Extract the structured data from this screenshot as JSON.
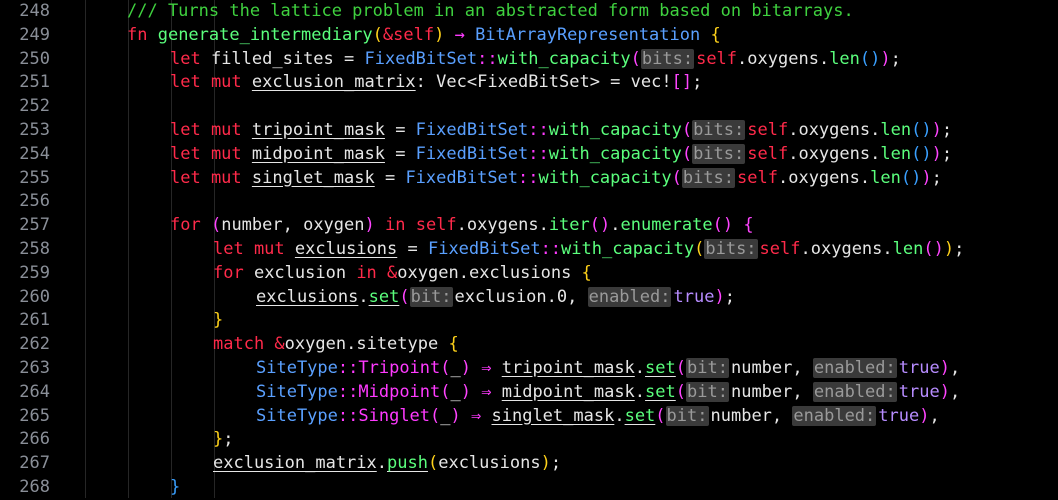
{
  "editor": {
    "lines": [
      {
        "n": "248",
        "tokens": [
          {
            "t": "/// Turns the lattice problem in an abstracted form based on bitarrays.",
            "c": "c"
          }
        ],
        "indent": 1
      },
      {
        "n": "249",
        "tokens": [
          {
            "t": "fn ",
            "c": "k"
          },
          {
            "t": "generate_intermediary",
            "c": "fn"
          },
          {
            "t": "(",
            "c": "br1"
          },
          {
            "t": "&self",
            "c": "k"
          },
          {
            "t": ")",
            "c": "br1"
          },
          {
            "t": " → ",
            "c": "ar"
          },
          {
            "t": "BitArrayRepresentation",
            "c": "ty"
          },
          {
            "t": " {",
            "c": "br1"
          }
        ],
        "indent": 1
      },
      {
        "n": "250",
        "tokens": [
          {
            "t": "let ",
            "c": "k"
          },
          {
            "t": "filled_sites",
            "c": "id"
          },
          {
            "t": " = ",
            "c": "p"
          },
          {
            "t": "FixedBitSet",
            "c": "ty"
          },
          {
            "t": "::",
            "c": "ar"
          },
          {
            "t": "with_capacity",
            "c": "fn"
          },
          {
            "t": "(",
            "c": "br2"
          },
          {
            "t": "bits:",
            "c": "hint"
          },
          {
            "t": "self",
            "c": "k"
          },
          {
            "t": ".",
            "c": "p"
          },
          {
            "t": "oxygens",
            "c": "id"
          },
          {
            "t": ".",
            "c": "p"
          },
          {
            "t": "len",
            "c": "fn"
          },
          {
            "t": "()",
            "c": "br3"
          },
          {
            "t": ")",
            "c": "br2"
          },
          {
            "t": ";",
            "c": "p"
          }
        ],
        "indent": 2
      },
      {
        "n": "251",
        "tokens": [
          {
            "t": "let mut ",
            "c": "k"
          },
          {
            "t": "exclusion_matrix",
            "c": "idu"
          },
          {
            "t": ": ",
            "c": "p"
          },
          {
            "t": "Vec",
            "c": "id"
          },
          {
            "t": "<",
            "c": "p"
          },
          {
            "t": "FixedBitSet",
            "c": "id"
          },
          {
            "t": "> = ",
            "c": "p"
          },
          {
            "t": "vec!",
            "c": "id"
          },
          {
            "t": "[]",
            "c": "br2"
          },
          {
            "t": ";",
            "c": "p"
          }
        ],
        "indent": 2
      },
      {
        "n": "252",
        "tokens": [],
        "indent": 2
      },
      {
        "n": "253",
        "tokens": [
          {
            "t": "let mut ",
            "c": "k"
          },
          {
            "t": "tripoint_mask",
            "c": "idu"
          },
          {
            "t": " = ",
            "c": "p"
          },
          {
            "t": "FixedBitSet",
            "c": "ty"
          },
          {
            "t": "::",
            "c": "ar"
          },
          {
            "t": "with_capacity",
            "c": "fn"
          },
          {
            "t": "(",
            "c": "br2"
          },
          {
            "t": "bits:",
            "c": "hint"
          },
          {
            "t": "self",
            "c": "k"
          },
          {
            "t": ".",
            "c": "p"
          },
          {
            "t": "oxygens",
            "c": "id"
          },
          {
            "t": ".",
            "c": "p"
          },
          {
            "t": "len",
            "c": "fn"
          },
          {
            "t": "()",
            "c": "br3"
          },
          {
            "t": ")",
            "c": "br2"
          },
          {
            "t": ";",
            "c": "p"
          }
        ],
        "indent": 2
      },
      {
        "n": "254",
        "tokens": [
          {
            "t": "let mut ",
            "c": "k"
          },
          {
            "t": "midpoint_mask",
            "c": "idu"
          },
          {
            "t": " = ",
            "c": "p"
          },
          {
            "t": "FixedBitSet",
            "c": "ty"
          },
          {
            "t": "::",
            "c": "ar"
          },
          {
            "t": "with_capacity",
            "c": "fn"
          },
          {
            "t": "(",
            "c": "br2"
          },
          {
            "t": "bits:",
            "c": "hint"
          },
          {
            "t": "self",
            "c": "k"
          },
          {
            "t": ".",
            "c": "p"
          },
          {
            "t": "oxygens",
            "c": "id"
          },
          {
            "t": ".",
            "c": "p"
          },
          {
            "t": "len",
            "c": "fn"
          },
          {
            "t": "()",
            "c": "br3"
          },
          {
            "t": ")",
            "c": "br2"
          },
          {
            "t": ";",
            "c": "p"
          }
        ],
        "indent": 2
      },
      {
        "n": "255",
        "tokens": [
          {
            "t": "let mut ",
            "c": "k"
          },
          {
            "t": "singlet_mask",
            "c": "idu"
          },
          {
            "t": " = ",
            "c": "p"
          },
          {
            "t": "FixedBitSet",
            "c": "ty"
          },
          {
            "t": "::",
            "c": "ar"
          },
          {
            "t": "with_capacity",
            "c": "fn"
          },
          {
            "t": "(",
            "c": "br2"
          },
          {
            "t": "bits:",
            "c": "hint"
          },
          {
            "t": "self",
            "c": "k"
          },
          {
            "t": ".",
            "c": "p"
          },
          {
            "t": "oxygens",
            "c": "id"
          },
          {
            "t": ".",
            "c": "p"
          },
          {
            "t": "len",
            "c": "fn"
          },
          {
            "t": "()",
            "c": "br3"
          },
          {
            "t": ")",
            "c": "br2"
          },
          {
            "t": ";",
            "c": "p"
          }
        ],
        "indent": 2
      },
      {
        "n": "256",
        "tokens": [],
        "indent": 2
      },
      {
        "n": "257",
        "tokens": [
          {
            "t": "for ",
            "c": "k"
          },
          {
            "t": "(",
            "c": "br2"
          },
          {
            "t": "number, oxygen",
            "c": "id"
          },
          {
            "t": ")",
            "c": "br2"
          },
          {
            "t": " in ",
            "c": "k"
          },
          {
            "t": "self",
            "c": "k"
          },
          {
            "t": ".",
            "c": "p"
          },
          {
            "t": "oxygens",
            "c": "id"
          },
          {
            "t": ".",
            "c": "p"
          },
          {
            "t": "iter",
            "c": "fn"
          },
          {
            "t": "()",
            "c": "br2"
          },
          {
            "t": ".",
            "c": "p"
          },
          {
            "t": "enumerate",
            "c": "fn"
          },
          {
            "t": "()",
            "c": "br2"
          },
          {
            "t": " {",
            "c": "br2"
          }
        ],
        "indent": 2
      },
      {
        "n": "258",
        "tokens": [
          {
            "t": "let mut ",
            "c": "k"
          },
          {
            "t": "exclusions",
            "c": "idu"
          },
          {
            "t": " = ",
            "c": "p"
          },
          {
            "t": "FixedBitSet",
            "c": "ty"
          },
          {
            "t": "::",
            "c": "ar"
          },
          {
            "t": "with_capacity",
            "c": "fn"
          },
          {
            "t": "(",
            "c": "br1"
          },
          {
            "t": "bits:",
            "c": "hint"
          },
          {
            "t": "self",
            "c": "k"
          },
          {
            "t": ".",
            "c": "p"
          },
          {
            "t": "oxygens",
            "c": "id"
          },
          {
            "t": ".",
            "c": "p"
          },
          {
            "t": "len",
            "c": "fn"
          },
          {
            "t": "()",
            "c": "br2"
          },
          {
            "t": ")",
            "c": "br1"
          },
          {
            "t": ";",
            "c": "p"
          }
        ],
        "indent": 3
      },
      {
        "n": "259",
        "tokens": [
          {
            "t": "for ",
            "c": "k"
          },
          {
            "t": "exclusion",
            "c": "id"
          },
          {
            "t": " in ",
            "c": "k"
          },
          {
            "t": "&",
            "c": "k"
          },
          {
            "t": "oxygen",
            "c": "id"
          },
          {
            "t": ".",
            "c": "p"
          },
          {
            "t": "exclusions",
            "c": "id"
          },
          {
            "t": " {",
            "c": "br1"
          }
        ],
        "indent": 3
      },
      {
        "n": "260",
        "tokens": [
          {
            "t": "exclusions",
            "c": "idu"
          },
          {
            "t": ".",
            "c": "p"
          },
          {
            "t": "set",
            "c": "fnu"
          },
          {
            "t": "(",
            "c": "br2"
          },
          {
            "t": "bit:",
            "c": "hint"
          },
          {
            "t": "exclusion.0, ",
            "c": "id"
          },
          {
            "t": "enabled:",
            "c": "hint"
          },
          {
            "t": "true",
            "c": "lit"
          },
          {
            "t": ")",
            "c": "br2"
          },
          {
            "t": ";",
            "c": "p"
          }
        ],
        "indent": 4
      },
      {
        "n": "261",
        "tokens": [
          {
            "t": "}",
            "c": "br1"
          }
        ],
        "indent": 3
      },
      {
        "n": "262",
        "tokens": [
          {
            "t": "match ",
            "c": "k"
          },
          {
            "t": "&",
            "c": "k"
          },
          {
            "t": "oxygen",
            "c": "id"
          },
          {
            "t": ".",
            "c": "p"
          },
          {
            "t": "sitetype",
            "c": "id"
          },
          {
            "t": " {",
            "c": "br1"
          }
        ],
        "indent": 3
      },
      {
        "n": "263",
        "tokens": [
          {
            "t": "SiteType",
            "c": "ty"
          },
          {
            "t": "::",
            "c": "ar"
          },
          {
            "t": "Tripoint",
            "c": "ar"
          },
          {
            "t": "(",
            "c": "br2"
          },
          {
            "t": "_",
            "c": "id"
          },
          {
            "t": ")",
            "c": "br2"
          },
          {
            "t": " ⇒ ",
            "c": "ar"
          },
          {
            "t": "tripoint_mask",
            "c": "idu"
          },
          {
            "t": ".",
            "c": "p"
          },
          {
            "t": "set",
            "c": "fnu"
          },
          {
            "t": "(",
            "c": "br2"
          },
          {
            "t": "bit:",
            "c": "hint"
          },
          {
            "t": "number, ",
            "c": "id"
          },
          {
            "t": "enabled:",
            "c": "hint"
          },
          {
            "t": "true",
            "c": "lit"
          },
          {
            "t": ")",
            "c": "br2"
          },
          {
            "t": ",",
            "c": "p"
          }
        ],
        "indent": 4
      },
      {
        "n": "264",
        "tokens": [
          {
            "t": "SiteType",
            "c": "ty"
          },
          {
            "t": "::",
            "c": "ar"
          },
          {
            "t": "Midpoint",
            "c": "ar"
          },
          {
            "t": "(",
            "c": "br2"
          },
          {
            "t": "_",
            "c": "id"
          },
          {
            "t": ")",
            "c": "br2"
          },
          {
            "t": " ⇒ ",
            "c": "ar"
          },
          {
            "t": "midpoint_mask",
            "c": "idu"
          },
          {
            "t": ".",
            "c": "p"
          },
          {
            "t": "set",
            "c": "fnu"
          },
          {
            "t": "(",
            "c": "br2"
          },
          {
            "t": "bit:",
            "c": "hint"
          },
          {
            "t": "number, ",
            "c": "id"
          },
          {
            "t": "enabled:",
            "c": "hint"
          },
          {
            "t": "true",
            "c": "lit"
          },
          {
            "t": ")",
            "c": "br2"
          },
          {
            "t": ",",
            "c": "p"
          }
        ],
        "indent": 4
      },
      {
        "n": "265",
        "tokens": [
          {
            "t": "SiteType",
            "c": "ty"
          },
          {
            "t": "::",
            "c": "ar"
          },
          {
            "t": "Singlet",
            "c": "ar"
          },
          {
            "t": "(",
            "c": "br2"
          },
          {
            "t": "_",
            "c": "id"
          },
          {
            "t": ")",
            "c": "br2"
          },
          {
            "t": " ⇒ ",
            "c": "ar"
          },
          {
            "t": "singlet_mask",
            "c": "idu"
          },
          {
            "t": ".",
            "c": "p"
          },
          {
            "t": "set",
            "c": "fnu"
          },
          {
            "t": "(",
            "c": "br2"
          },
          {
            "t": "bit:",
            "c": "hint"
          },
          {
            "t": "number, ",
            "c": "id"
          },
          {
            "t": "enabled:",
            "c": "hint"
          },
          {
            "t": "true",
            "c": "lit"
          },
          {
            "t": ")",
            "c": "br2"
          },
          {
            "t": ",",
            "c": "p"
          }
        ],
        "indent": 4
      },
      {
        "n": "266",
        "tokens": [
          {
            "t": "}",
            "c": "br1"
          },
          {
            "t": ";",
            "c": "p"
          }
        ],
        "indent": 3
      },
      {
        "n": "267",
        "tokens": [
          {
            "t": "exclusion_matrix",
            "c": "idu"
          },
          {
            "t": ".",
            "c": "p"
          },
          {
            "t": "push",
            "c": "fnu"
          },
          {
            "t": "(",
            "c": "br1"
          },
          {
            "t": "exclusions",
            "c": "id"
          },
          {
            "t": ")",
            "c": "br1"
          },
          {
            "t": ";",
            "c": "p"
          }
        ],
        "indent": 3
      },
      {
        "n": "268",
        "tokens": [
          {
            "t": "}",
            "c": "br3"
          }
        ],
        "indent": 2
      }
    ]
  }
}
